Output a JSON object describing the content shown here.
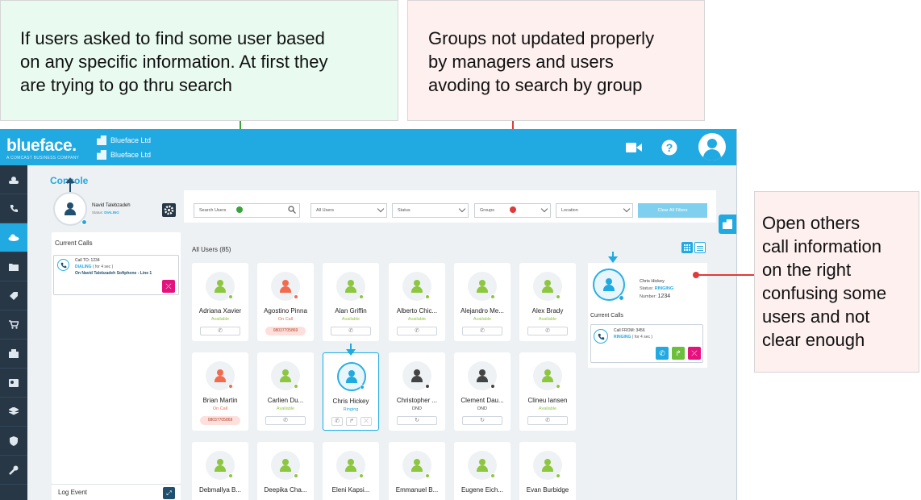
{
  "annotations": {
    "search_note": [
      "If users asked to find some user based",
      "on any specific information. At first they",
      "are trying to go thru search"
    ],
    "groups_note": [
      "Groups not updated properly",
      "by managers and users",
      "avoding to search by group"
    ],
    "right_note": [
      "Open others",
      "call information",
      "on the right",
      "confusing some",
      "users and not",
      "clear enough"
    ]
  },
  "app": {
    "brand": "blueface.",
    "brand_sub": "A COMCAST BUSINESS COMPANY",
    "orgs": [
      "Blueface Ltd",
      "Blueface Ltd"
    ],
    "console_title": "Console",
    "me": {
      "name": "Navid Talebzadeh",
      "status_label": "Status:",
      "status": "DIALING"
    },
    "current_calls_title": "Current Calls",
    "my_call": {
      "to": "Call TO: 1234",
      "state": "DIALING",
      "elapsed": "( for 4 sec )",
      "line": "On Navid Talebzadeh Softphone - Line 1"
    },
    "log_event": "Log Event",
    "filters": {
      "search_placeholder": "Search Users",
      "all_users": "All Users",
      "status": "Status",
      "groups": "Groups",
      "location": "Location",
      "clear": "Clear All Filters"
    },
    "all_users_title": "All Users (85)",
    "users": [
      {
        "name": "Adriana Xavier",
        "status": "Available"
      },
      {
        "name": "Agostino Pinna",
        "status": "On Call",
        "number": "08037705869"
      },
      {
        "name": "Alan Griffin",
        "status": "Available"
      },
      {
        "name": "Alberto Chic...",
        "status": "Available"
      },
      {
        "name": "Alejandro Me...",
        "status": "Available"
      },
      {
        "name": "Alex Brady",
        "status": "Available"
      },
      {
        "name": "Brian Martin",
        "status": "On Call",
        "number": "08037705869"
      },
      {
        "name": "Carlien Du...",
        "status": "Available"
      },
      {
        "name": "Chris Hickey",
        "status": "Ringing"
      },
      {
        "name": "Christopher ...",
        "status": "DND"
      },
      {
        "name": "Clement Dau...",
        "status": "DND"
      },
      {
        "name": "Clineu Iansen",
        "status": "Available"
      },
      {
        "name": "Debmallya B...",
        "status": ""
      },
      {
        "name": "Deepika Cha...",
        "status": ""
      },
      {
        "name": "Eleni Kapsi...",
        "status": ""
      },
      {
        "name": "Emmanuel B...",
        "status": ""
      },
      {
        "name": "Eugene Eich...",
        "status": ""
      },
      {
        "name": "Evan Burbidge",
        "status": ""
      }
    ],
    "selected": {
      "name": "Chris Hickey",
      "status_label": "Status:",
      "status": "RINGING",
      "number_label": "Number:",
      "number": "1234",
      "current_calls": "Current Calls",
      "call_from": "Call FROM: 3456",
      "call_state": "RINGING",
      "call_elapsed": "( for 4 sec )"
    },
    "colors": {
      "brand": "#21a9e1",
      "available": "#8dc63f",
      "oncall": "#f26b4f",
      "dnd": "#444444",
      "ringing": "#21a9e1",
      "nav": "#283746"
    }
  }
}
